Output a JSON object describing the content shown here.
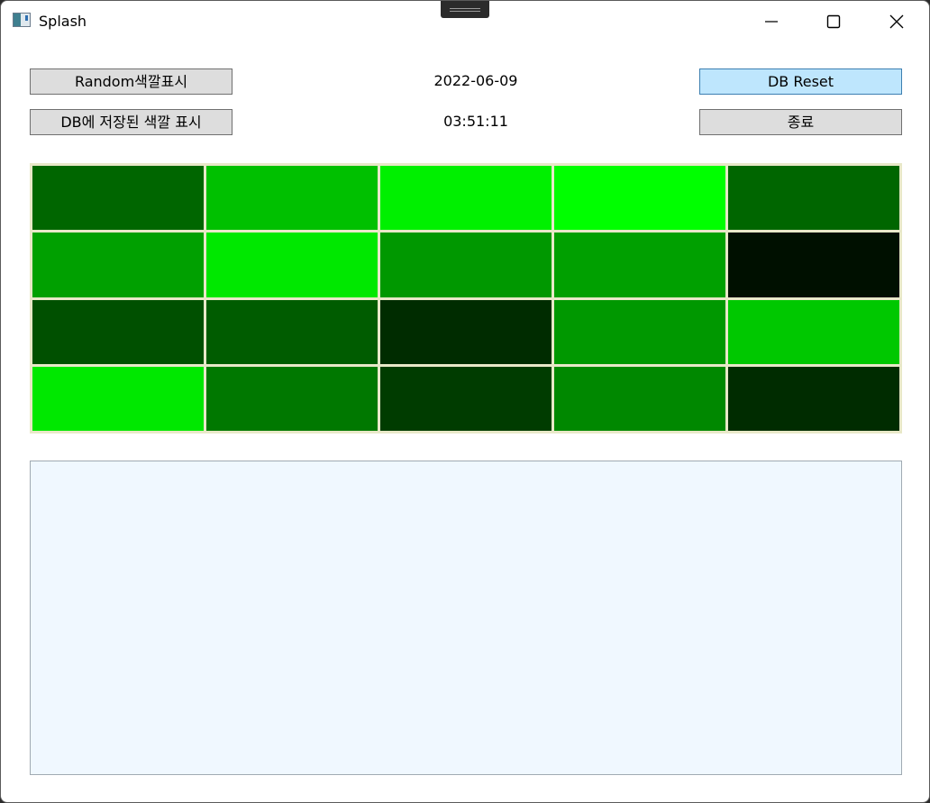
{
  "window": {
    "title": "Splash",
    "icon": "app-window-icon",
    "controls": [
      "minimize-icon",
      "maximize-icon",
      "close-icon"
    ]
  },
  "toolbar": {
    "random_label": "Random색깔표시",
    "db_show_label": "DB에 저장된 색깔 표시",
    "date": "2022-06-09",
    "time": "03:51:11",
    "db_reset_label": "DB Reset",
    "exit_label": "종료"
  },
  "colors": {
    "button_bg": "#dddddd",
    "button_accent_bg": "#bee6fd",
    "textarea_bg": "#f0f8ff",
    "grid_line": "#e8e8c8"
  },
  "color_grid": {
    "rows": 4,
    "cols": 5,
    "cells": [
      [
        "#006600",
        "#00c000",
        "#00f000",
        "#00ff00",
        "#006600"
      ],
      [
        "#00a000",
        "#00e800",
        "#009800",
        "#00a000",
        "#001000"
      ],
      [
        "#005000",
        "#005c00",
        "#002c00",
        "#009800",
        "#00c800"
      ],
      [
        "#00e800",
        "#007800",
        "#003c00",
        "#008800",
        "#002c00"
      ]
    ]
  },
  "output": {
    "value": ""
  }
}
